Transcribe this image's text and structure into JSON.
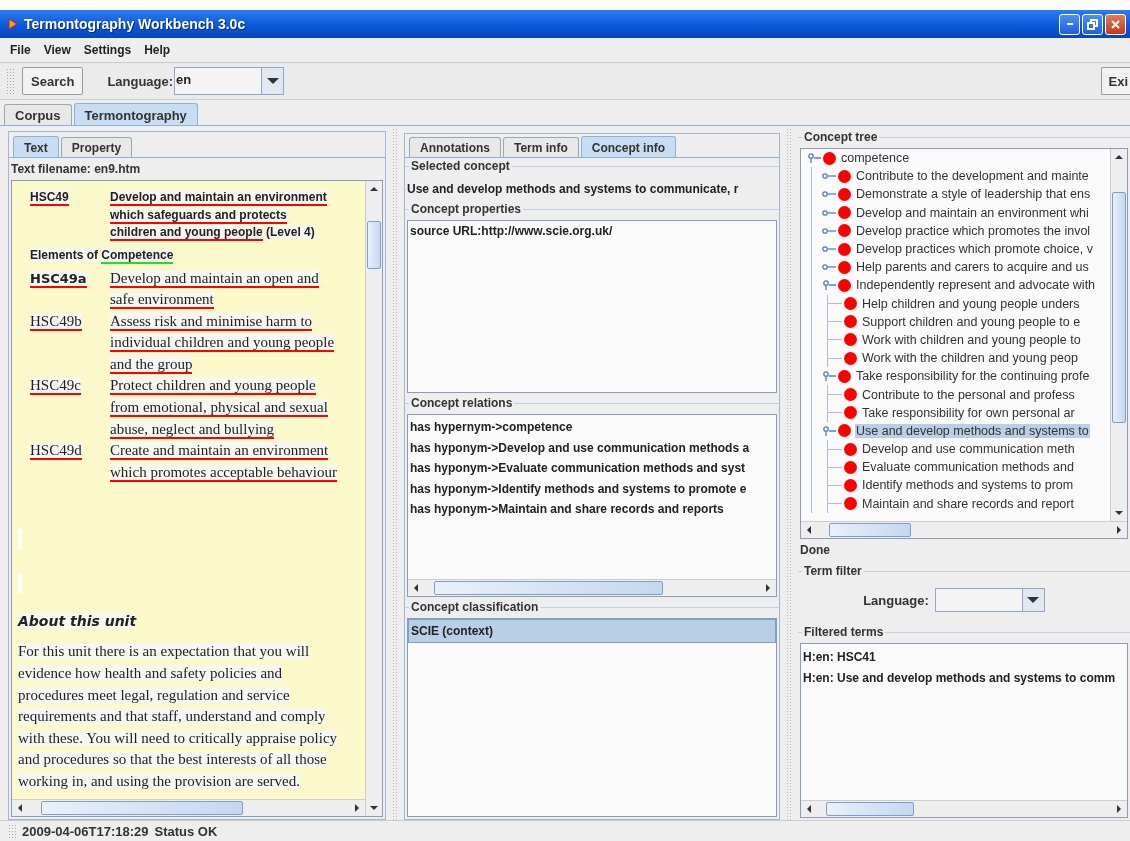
{
  "window": {
    "title": "Termontography Workbench 3.0c"
  },
  "menu": [
    "File",
    "View",
    "Settings",
    "Help"
  ],
  "toolbar": {
    "search_button": "Search",
    "language_label": "Language:",
    "language_value": "en",
    "exit_button": "Exi"
  },
  "main_tabs": [
    {
      "label": "Corpus",
      "selected": false
    },
    {
      "label": "Termontography",
      "selected": true
    }
  ],
  "text_panel": {
    "tabs": [
      {
        "label": "Text",
        "selected": true
      },
      {
        "label": "Property",
        "selected": false
      }
    ],
    "filename": "Text filename: en9.htm",
    "unit": {
      "code": {
        "text": "HSC49",
        "color": "#ff0000"
      },
      "title": {
        "text": "Develop and maintain an environment which safeguards and protects children and young people",
        "color": "#ff0000"
      },
      "level": "(Level 4)"
    },
    "elements_heading": {
      "text": "Elements of",
      "term": {
        "text": "Competence",
        "color": "#22dd22"
      }
    },
    "elements": [
      {
        "bold": true,
        "code": {
          "text": "HSC49a",
          "color": "#ff0000"
        },
        "text": {
          "text": "Develop and maintain an open and safe environment",
          "color": "#ff0000"
        }
      },
      {
        "bold": false,
        "code": {
          "text": "HSC49b",
          "color": "#ff0000"
        },
        "text": {
          "text": "Assess risk and minimise harm to individual children and young people and the group",
          "color": "#ff0000"
        }
      },
      {
        "bold": false,
        "code": {
          "text": "HSC49c",
          "color": "#ff0000"
        },
        "text": {
          "text": "Protect children and young people from emotional, physical and sexual abuse, neglect and bullying",
          "color": "#ff0000"
        }
      },
      {
        "bold": false,
        "code": {
          "text": "HSC49d",
          "color": "#ff0000"
        },
        "text": {
          "text": "Create and maintain an environment which promotes acceptable behaviour",
          "color": "#ff0000"
        }
      }
    ],
    "about_heading": "About this unit",
    "about_text": "For this unit there is an expectation that you will evidence how health and safety policies and procedures meet legal, regulation and service requirements and that staff, understand and comply with these.  You will need to critically appraise policy and procedures so that the best interests of all those working in, and using the provision are served."
  },
  "concept_panel": {
    "tabs": [
      {
        "label": "Annotations",
        "selected": false
      },
      {
        "label": "Term info",
        "selected": false
      },
      {
        "label": "Concept info",
        "selected": true
      }
    ],
    "selected_concept": {
      "title": "Selected concept",
      "value": "Use and develop methods and systems to communicate, r"
    },
    "properties": {
      "title": "Concept properties",
      "items": [
        "source URL:http://www.scie.org.uk/"
      ]
    },
    "relations": {
      "title": "Concept relations",
      "items": [
        "has hypernym->competence",
        "has hyponym->Develop and use communication methods a",
        "has hyponym->Evaluate communication methods and syst",
        "has hyponym->Identify methods and systems to promote e",
        "has hyponym->Maintain and share records and reports"
      ]
    },
    "classification": {
      "title": "Concept classification",
      "items": [
        {
          "label": "SCIE (context)",
          "selected": true
        }
      ]
    }
  },
  "tree_panel": {
    "title": "Concept tree",
    "tree": [
      {
        "label": "competence",
        "kind": "branch",
        "expanded": true,
        "selected": false,
        "children": [
          {
            "label": "Contribute to the development and mainte",
            "kind": "branch",
            "expanded": false,
            "selected": false
          },
          {
            "label": "Demonstrate a style of leadership that ens",
            "kind": "branch",
            "expanded": false,
            "selected": false
          },
          {
            "label": "Develop and maintain an environment whi",
            "kind": "branch",
            "expanded": false,
            "selected": false
          },
          {
            "label": "Develop practice which promotes the invol",
            "kind": "branch",
            "expanded": false,
            "selected": false
          },
          {
            "label": "Develop practices which promote choice, v",
            "kind": "branch",
            "expanded": false,
            "selected": false
          },
          {
            "label": "Help parents and carers to acquire and us",
            "kind": "branch",
            "expanded": false,
            "selected": false
          },
          {
            "label": "Independently represent and advocate with",
            "kind": "branch",
            "expanded": true,
            "selected": false,
            "children": [
              {
                "label": "Help children and young people unders",
                "kind": "leaf",
                "selected": false
              },
              {
                "label": "Support children and young people to e",
                "kind": "leaf",
                "selected": false
              },
              {
                "label": "Work with children and young people to",
                "kind": "leaf",
                "selected": false
              },
              {
                "label": "Work with the children and young peop",
                "kind": "leaf",
                "selected": false
              }
            ]
          },
          {
            "label": "Take responsibility for the continuing profe",
            "kind": "branch",
            "expanded": true,
            "selected": false,
            "children": [
              {
                "label": "Contribute to the personal and profess",
                "kind": "leaf",
                "selected": false
              },
              {
                "label": "Take responsibility for own personal ar",
                "kind": "leaf",
                "selected": false
              }
            ]
          },
          {
            "label": "Use and develop methods and systems to",
            "kind": "branch",
            "expanded": true,
            "selected": true,
            "children": [
              {
                "label": "Develop and use communication meth",
                "kind": "leaf",
                "selected": false
              },
              {
                "label": "Evaluate communication methods and",
                "kind": "leaf",
                "selected": false
              },
              {
                "label": "Identify methods and systems to prom",
                "kind": "leaf",
                "selected": false
              },
              {
                "label": "Maintain and share records and report",
                "kind": "leaf",
                "selected": false
              }
            ]
          }
        ]
      }
    ],
    "progress": "Done",
    "term_filter": {
      "title": "Term filter",
      "language_label": "Language:"
    },
    "filtered_terms": {
      "title": "Filtered terms",
      "items": [
        "H:en: HSC41",
        "H:en: Use and develop methods and systems to comm"
      ]
    }
  },
  "status_bar": {
    "timestamp": "2009-04-06T17:18:29",
    "status": "Status OK"
  }
}
